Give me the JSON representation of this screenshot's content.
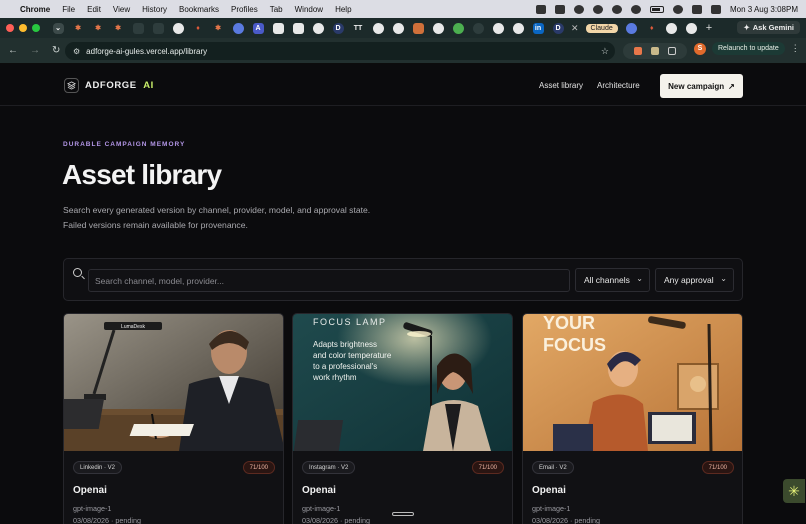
{
  "menubar": {
    "app": "Chrome",
    "menus": [
      "File",
      "Edit",
      "View",
      "History",
      "Bookmarks",
      "Profiles",
      "Tab",
      "Window",
      "Help"
    ],
    "clock": "Mon 3 Aug  3:08PM"
  },
  "tabs": {
    "active_label": "Claude",
    "ask_gemini": "Ask Gemini"
  },
  "address": {
    "url": "adforge-ai-gules.vercel.app/library",
    "profile_initial": "S",
    "relaunch": "Relaunch to update"
  },
  "header": {
    "brand_name": "ADFORGE",
    "brand_suffix": "AI",
    "nav": [
      "Asset library",
      "Architecture"
    ],
    "cta": "New campaign",
    "cta_icon": "↗"
  },
  "hero": {
    "eyebrow": "DURABLE CAMPAIGN MEMORY",
    "title": "Asset library",
    "subtitle_line1": "Search every generated version by channel, provider, model, and approval state.",
    "subtitle_line2": "Failed versions remain available for provenance."
  },
  "filters": {
    "search_placeholder": "Search channel, model, provider...",
    "channel_value": "All channels",
    "approval_value": "Any approval"
  },
  "cards": [
    {
      "chip": "Linkedin · V2",
      "score": "71/100",
      "title": "Openai",
      "model": "gpt-image-1",
      "meta": "03/08/2026 · pending",
      "image_text": "LumaDesk"
    },
    {
      "chip": "Instagram · V2",
      "score": "71/100",
      "title": "Openai",
      "model": "gpt-image-1",
      "meta": "03/08/2026 · pending",
      "image_headline": "FOCUS LAMP",
      "image_copy": [
        "Adapts brightness",
        "and color temperature",
        "to a professional's",
        "work rhythm"
      ]
    },
    {
      "chip": "Email · V2",
      "score": "71/100",
      "title": "Openai",
      "model": "gpt-image-1",
      "meta": "03/08/2026 · pending",
      "image_headline": [
        "YOUR",
        "FOCUS"
      ]
    }
  ],
  "colors": {
    "background": "#0b0b0d",
    "accent_lime": "#c9ee6a",
    "eyebrow_purple": "#b396e6",
    "score_text": "#f0b7a5"
  }
}
